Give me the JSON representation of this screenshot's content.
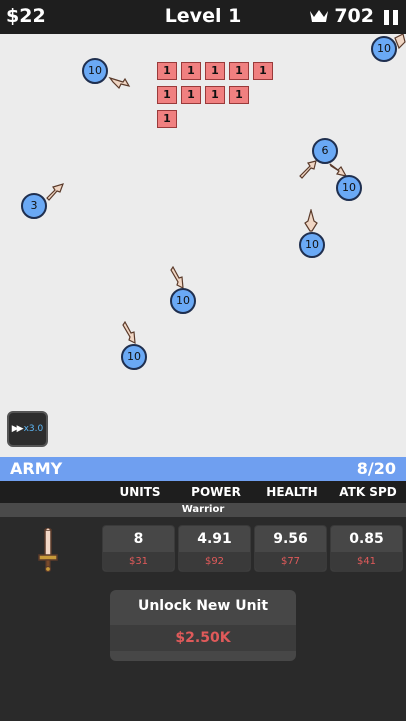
{
  "header": {
    "money": "$22",
    "level": "Level 1",
    "score": "702"
  },
  "bricks": [
    {
      "label": "1"
    },
    {
      "label": "1"
    },
    {
      "label": "1"
    },
    {
      "label": "1"
    },
    {
      "label": "1"
    },
    {
      "label": "1"
    },
    {
      "label": "1"
    },
    {
      "label": "1"
    },
    {
      "label": "1"
    },
    {
      "label": "1"
    }
  ],
  "units": [
    {
      "label": "10"
    },
    {
      "label": "10"
    },
    {
      "label": "6"
    },
    {
      "label": "10"
    },
    {
      "label": "3"
    },
    {
      "label": "10"
    },
    {
      "label": "10"
    },
    {
      "label": "10"
    }
  ],
  "speed": {
    "multiplier": "x3.0"
  },
  "army": {
    "title": "ARMY",
    "count": "8/20"
  },
  "columns": [
    "UNITS",
    "POWER",
    "HEALTH",
    "ATK SPD"
  ],
  "unit_class": "Warrior",
  "stats": [
    {
      "value": "8",
      "cost": "$31"
    },
    {
      "value": "4.91",
      "cost": "$92"
    },
    {
      "value": "9.56",
      "cost": "$77"
    },
    {
      "value": "0.85",
      "cost": "$41"
    }
  ],
  "unlock": {
    "title": "Unlock New Unit",
    "price": "$2.50K"
  },
  "colors": {
    "unit": "#6aa9f5",
    "brick": "#f08080",
    "army_bar": "#6f9ff0",
    "cost": "#e05a5a"
  }
}
